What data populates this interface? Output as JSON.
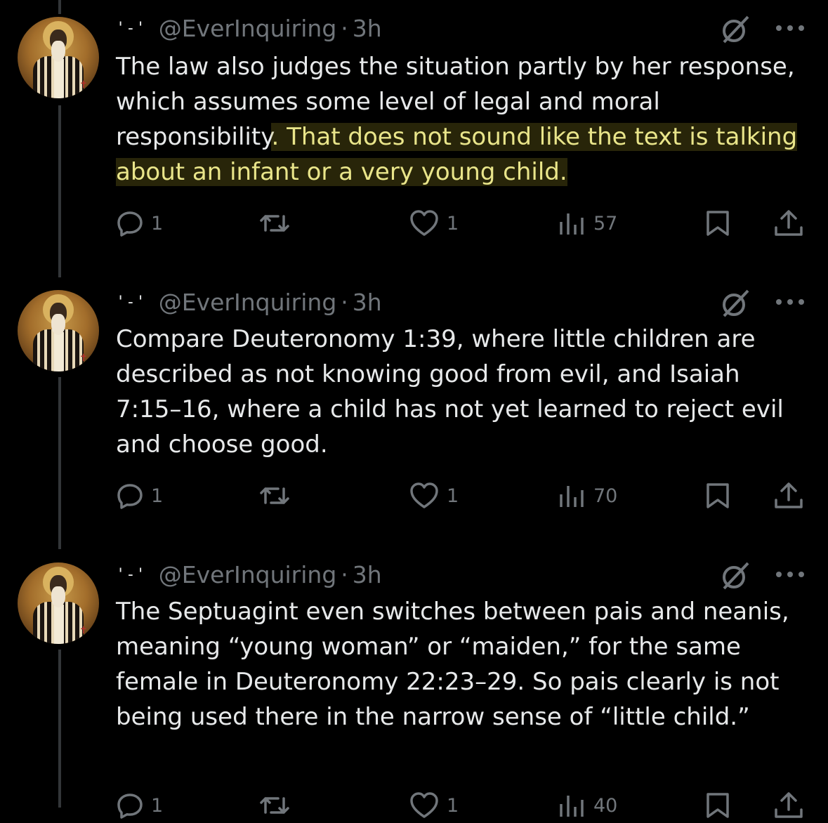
{
  "tweets": [
    {
      "badge": "'-'",
      "handle": "@EverInquiring",
      "separator": "·",
      "time": "3h",
      "text_plain": "The law also judges the situation partly by her response, which assumes some level of legal and moral responsibility",
      "text_highlight": ". That does not sound like the text is talking about an infant or a very young child.",
      "replies": "1",
      "likes": "1",
      "views": "57"
    },
    {
      "badge": "'-'",
      "handle": "@EverInquiring",
      "separator": "·",
      "time": "3h",
      "text_plain": "Compare Deuteronomy 1:39, where little children are described as not knowing good from evil, and Isaiah 7:15–16, where a child has not yet learned to reject evil and choose good.",
      "text_highlight": "",
      "replies": "1",
      "likes": "1",
      "views": "70"
    },
    {
      "badge": "'-'",
      "handle": "@EverInquiring",
      "separator": "·",
      "time": "3h",
      "text_plain": "The Septuagint even switches between pais and neanis, meaning “young woman” or “maiden,” for the same female in Deuteronomy 22:23–29. So pais clearly is not being used there in the narrow sense of “little child.”",
      "text_highlight": "",
      "replies": "1",
      "likes": "1",
      "views": "40"
    }
  ],
  "colors": {
    "background": "#000000",
    "text": "#e7e9ea",
    "secondary": "#71767b",
    "highlight_text": "#e9e58a"
  },
  "icons": [
    "reply-icon",
    "retweet-icon",
    "like-icon",
    "views-icon",
    "bookmark-icon",
    "share-icon",
    "mute-icon",
    "more-icon"
  ]
}
